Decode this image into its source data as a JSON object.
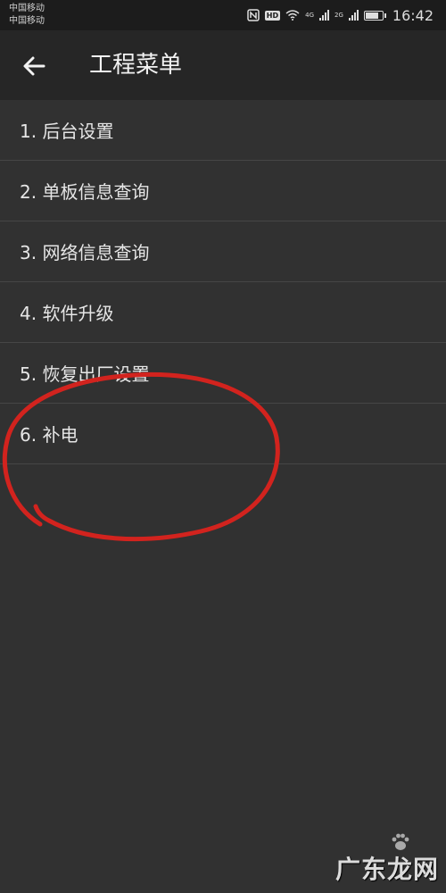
{
  "status_bar": {
    "carrier_1": "中国移动",
    "carrier_2": "中国移动",
    "net_1": "4G",
    "net_2": "2G",
    "hd": "HD",
    "battery_level": 0.85,
    "time": "16:42"
  },
  "header": {
    "title": "工程菜单"
  },
  "menu": {
    "items": [
      {
        "label": "1. 后台设置"
      },
      {
        "label": "2. 单板信息查询"
      },
      {
        "label": "3. 网络信息查询"
      },
      {
        "label": "4. 软件升级"
      },
      {
        "label": "5. 恢复出厂设置"
      },
      {
        "label": "6. 补电"
      }
    ]
  },
  "annotation": {
    "color": "#d2231e"
  },
  "watermark": {
    "text": "广东龙网"
  },
  "colors": {
    "background": "#313131",
    "app_bar": "#262626",
    "status_bar": "#1c1c1c",
    "divider": "#464646"
  }
}
